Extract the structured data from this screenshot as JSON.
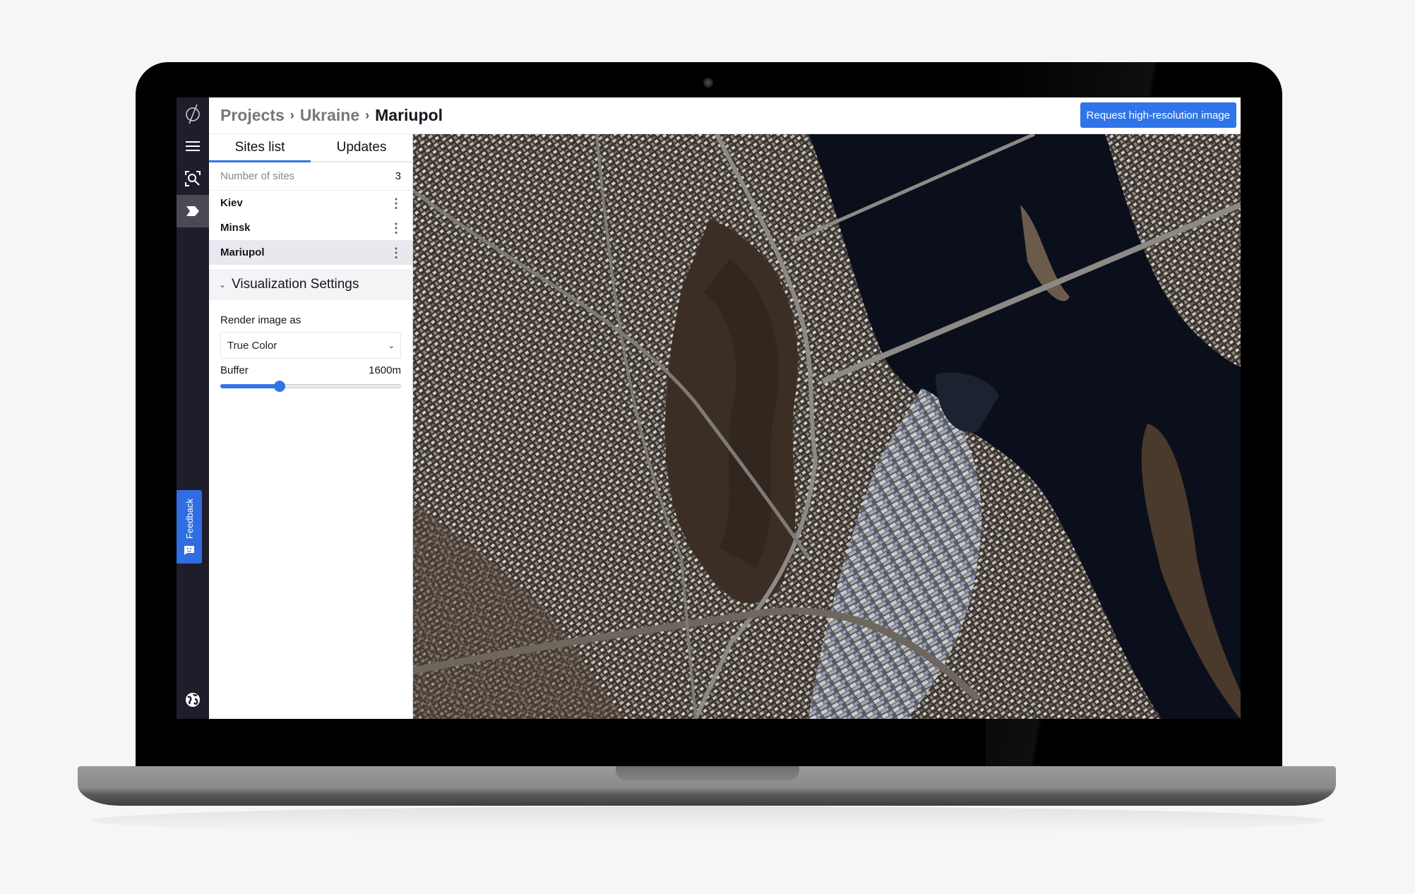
{
  "app": {
    "breadcrumb": [
      "Projects",
      "Ukraine",
      "Mariupol"
    ],
    "request_button": "Request high-resolution image"
  },
  "rail": {
    "icons": [
      "logo-icon",
      "menu-icon",
      "search-scan-icon",
      "tag-icon",
      "globe-icon"
    ],
    "active": "tag-icon",
    "feedback_label": "Feedback"
  },
  "tabs": [
    {
      "label": "Sites list",
      "active": true
    },
    {
      "label": "Updates",
      "active": false
    }
  ],
  "sites": {
    "count_label": "Number of sites",
    "count": "3",
    "items": [
      {
        "name": "Kiev",
        "selected": false
      },
      {
        "name": "Minsk",
        "selected": false
      },
      {
        "name": "Mariupol",
        "selected": true
      }
    ]
  },
  "visualization": {
    "title": "Visualization Settings",
    "render_label": "Render image as",
    "render_value": "True Color",
    "buffer_label": "Buffer",
    "buffer_value": "1600m",
    "buffer_fraction": 0.33
  },
  "colors": {
    "accent": "#2f75e8",
    "rail_bg": "#1f1d2b",
    "feedback_bg": "#2f6de1"
  }
}
